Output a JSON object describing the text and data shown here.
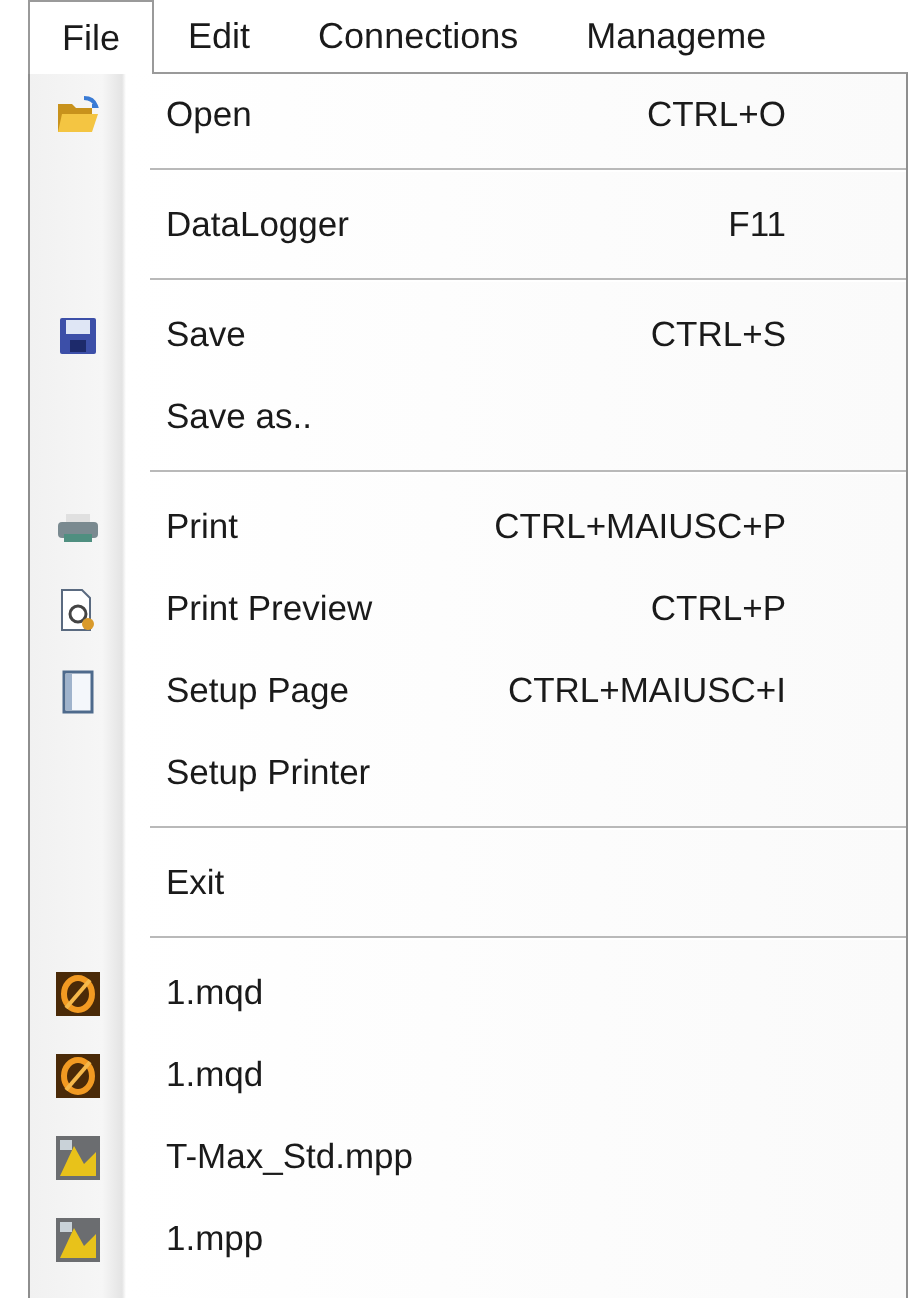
{
  "menubar": [
    {
      "label": "File",
      "selected": true
    },
    {
      "label": "Edit",
      "selected": false
    },
    {
      "label": "Connections",
      "selected": false
    },
    {
      "label": "Manageme",
      "selected": false
    }
  ],
  "menu": {
    "items": [
      {
        "kind": "item",
        "label": "Open",
        "shortcut": "CTRL+O"
      },
      {
        "kind": "separator"
      },
      {
        "kind": "item",
        "label": "DataLogger",
        "shortcut": "F11"
      },
      {
        "kind": "separator"
      },
      {
        "kind": "item",
        "label": "Save",
        "shortcut": "CTRL+S"
      },
      {
        "kind": "item",
        "label": "Save as.."
      },
      {
        "kind": "separator"
      },
      {
        "kind": "item",
        "label": "Print",
        "shortcut": "CTRL+MAIUSC+P"
      },
      {
        "kind": "item",
        "label": "Print Preview",
        "shortcut": "CTRL+P"
      },
      {
        "kind": "item",
        "label": "Setup Page",
        "shortcut": "CTRL+MAIUSC+I"
      },
      {
        "kind": "item",
        "label": "Setup Printer"
      },
      {
        "kind": "separator"
      },
      {
        "kind": "item",
        "label": "Exit"
      },
      {
        "kind": "separator"
      },
      {
        "kind": "item",
        "label": "1.mqd"
      },
      {
        "kind": "item",
        "label": "1.mqd"
      },
      {
        "kind": "item",
        "label": "T-Max_Std.mpp"
      },
      {
        "kind": "item",
        "label": "1.mpp"
      }
    ]
  }
}
